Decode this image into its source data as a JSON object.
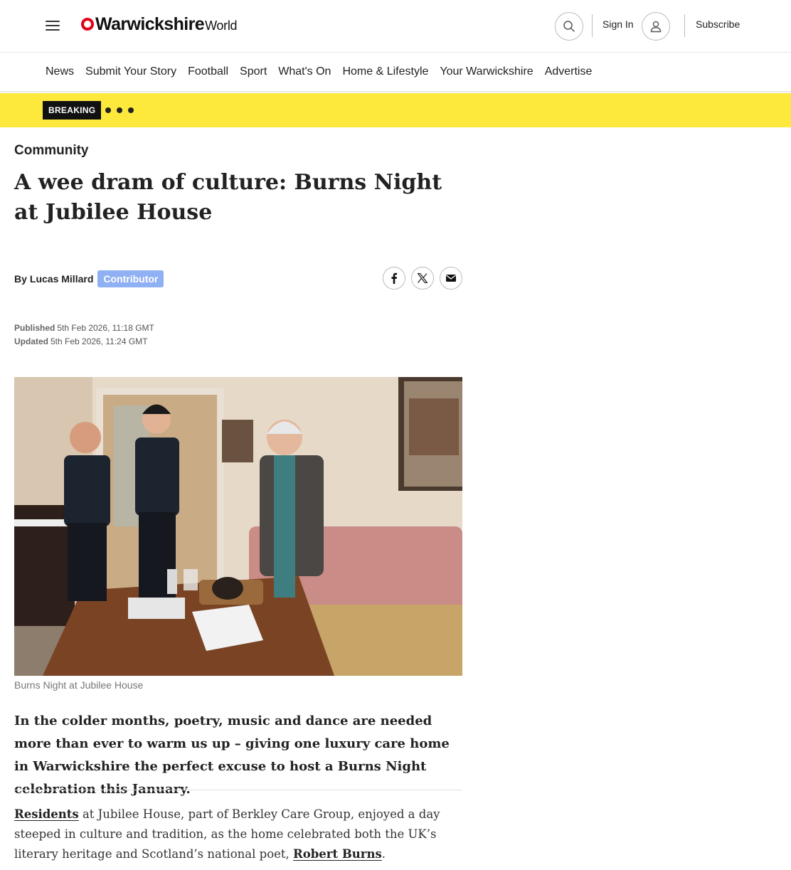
{
  "header": {
    "logo_main": "Warwickshire",
    "logo_sub": "World",
    "sign_in": "Sign In",
    "subscribe": "Subscribe"
  },
  "nav": {
    "items": [
      {
        "label": "News"
      },
      {
        "label": "Submit Your Story"
      },
      {
        "label": "Football"
      },
      {
        "label": "Sport"
      },
      {
        "label": "What's On"
      },
      {
        "label": "Home & Lifestyle"
      },
      {
        "label": "Your Warwickshire"
      },
      {
        "label": "Advertise"
      }
    ]
  },
  "breaking": {
    "label": "BREAKING"
  },
  "article": {
    "section": "Community",
    "headline": "A wee dram of culture: Burns Night at Jubilee House",
    "byline_prefix": "By",
    "author": "Lucas Millard",
    "author_role": "Contributor",
    "published_label": "Published",
    "published": "5th Feb 2026, 11:18 GMT",
    "updated_label": "Updated",
    "updated": "5th Feb 2026, 11:24 GMT",
    "image_caption": "Burns Night at Jubilee House",
    "standfirst": "In the colder months, poetry, music and dance are needed more than ever to warm us up – giving one luxury care home in Warwickshire the perfect excuse to host a Burns Night celebration this January.",
    "body_link_1": "Residents",
    "body_text_1": " at Jubilee House, part of Berkley Care Group, enjoyed a day steeped in culture and tradition, as the home celebrated both the UK’s literary heritage and Scotland’s national poet, ",
    "body_link_2": "Robert Burns",
    "body_text_2": "."
  },
  "icons": {
    "menu": "hamburger-menu-icon",
    "search": "search-icon",
    "user": "user-icon",
    "facebook": "facebook-icon",
    "x": "x-twitter-icon",
    "email": "email-icon"
  },
  "colors": {
    "brand_red": "#e1001a",
    "breaking_bar": "#fde93b",
    "contributor_badge": "#8fb0f3"
  }
}
